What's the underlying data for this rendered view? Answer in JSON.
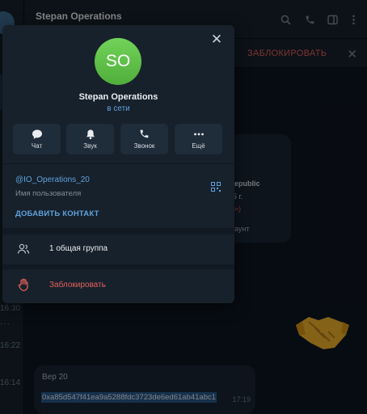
{
  "chat": {
    "title": "Stepan Operations",
    "block_bar_label": "ЗАБЛОКИРОВАТЬ",
    "timestamps": [
      "16:30",
      "16:22",
      "16:14"
    ],
    "upper_message_fragments": [
      "epublic",
      "5 г.",
      "»)",
      "аунт"
    ],
    "lower_message": {
      "sender": "Bep 20",
      "address": "0xa85d547f41ea9a5288fdc3723de6ed61ab41abc1",
      "time": "17:19"
    }
  },
  "profile": {
    "avatar_initials": "SO",
    "avatar_color": "#5cbf44",
    "name": "Stepan Operations",
    "status": "в сети",
    "actions": [
      {
        "label": "Чат",
        "icon": "chat-icon"
      },
      {
        "label": "Звук",
        "icon": "bell-icon"
      },
      {
        "label": "Звонок",
        "icon": "phone-icon"
      },
      {
        "label": "Ещё",
        "icon": "more-icon"
      }
    ],
    "username": "@IO_Operations_20",
    "username_caption": "Имя пользователя",
    "add_contact": "ДОБАВИТЬ КОНТАКТ",
    "groups_label": "1 общая группа",
    "block_label": "Заблокировать"
  },
  "colors": {
    "accent": "#5ea2dd",
    "danger": "#e8605e",
    "panel": "#17212b",
    "background": "#0e1621"
  }
}
